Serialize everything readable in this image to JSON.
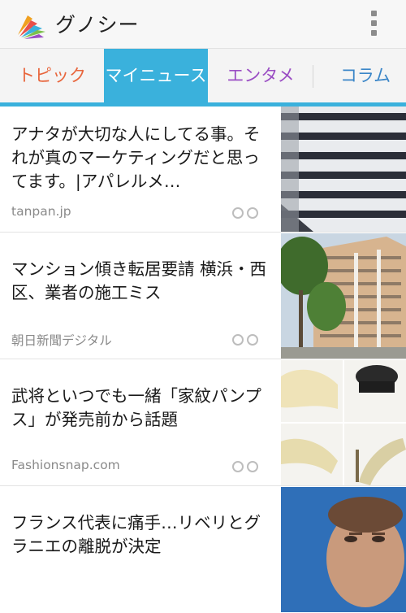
{
  "app": {
    "title": "グノシー",
    "logo_icon": "gunosy-logo-icon",
    "menu_icon": "overflow-menu-icon"
  },
  "tabs": [
    {
      "label": "トピック",
      "color": "#e8663d",
      "active": false
    },
    {
      "label": "マイニュース",
      "color": "#ffffff",
      "active": true
    },
    {
      "label": "エンタメ",
      "color": "#9b4fc4",
      "active": false
    },
    {
      "label": "コラム",
      "color": "#3b86c8",
      "active": false
    }
  ],
  "colors": {
    "accent": "#3ab1dc",
    "appbar": "#f7f7f7",
    "text": "#1a1a1a",
    "source": "#8a8a8a"
  },
  "articles": [
    {
      "title": "アナタが大切な人にしてる事。それが真のマーケティングだと思ってます。|アパレルメ…",
      "source": "tanpan.jp",
      "thumbnail": "striped-shorts-photo"
    },
    {
      "title": "マンション傾き転居要請 横浜・西区、業者の施工ミス",
      "source": "朝日新聞デジタル",
      "thumbnail": "apartment-building-photo"
    },
    {
      "title": "武将といつでも一緒「家紋パンプス」が発売前から話題",
      "source": "Fashionsnap.com",
      "thumbnail": "pumps-shoes-photo"
    },
    {
      "title": "フランス代表に痛手…リベリとグラニエの離脱が決定",
      "source": "",
      "thumbnail": "football-player-photo"
    }
  ]
}
